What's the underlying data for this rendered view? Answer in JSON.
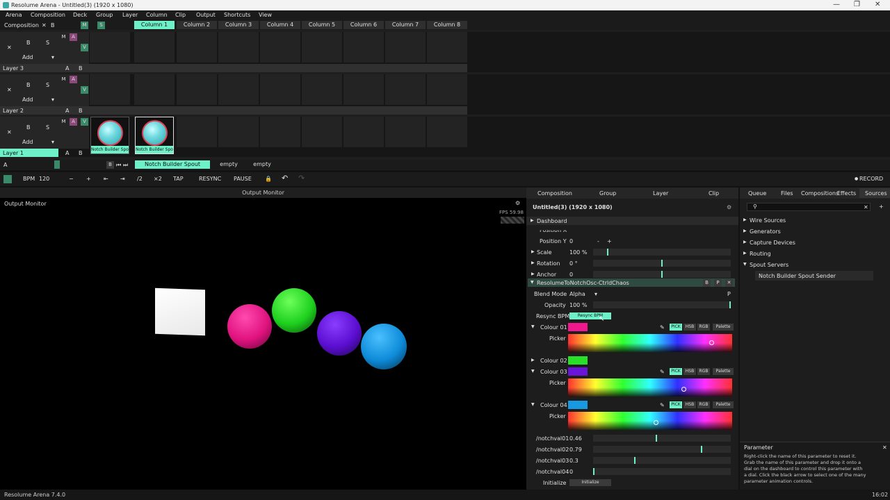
{
  "window": {
    "title": "Resolume Arena - Untitled(3) (1920 x 1080)",
    "min": "—",
    "max": "❐",
    "close": "✕"
  },
  "menu": [
    "Arena",
    "Composition",
    "Deck",
    "Group",
    "Layer",
    "Column",
    "Clip",
    "Output",
    "Shortcuts",
    "View"
  ],
  "composition_label": "Composition",
  "comp_x": "✕",
  "comp_b": "B",
  "comp_m": "M",
  "comp_s": "S",
  "columns": [
    "Column 1",
    "Column 2",
    "Column 3",
    "Column 4",
    "Column 5",
    "Column 6",
    "Column 7",
    "Column 8"
  ],
  "layers": [
    {
      "name": "Layer 3",
      "add": "Add"
    },
    {
      "name": "Layer 2",
      "add": "Add"
    },
    {
      "name": "Layer 1",
      "add": "Add"
    }
  ],
  "layer_btn": {
    "x": "✕",
    "b": "B",
    "s": "S",
    "m": "M",
    "a": "A",
    "v": "V",
    "ab_a": "A",
    "ab_b": "B"
  },
  "clips": [
    "Notch Builder Spo...",
    "Notch Builder Spo..."
  ],
  "crossfader": {
    "a": "A",
    "b": "B"
  },
  "deck_tabs": [
    "Notch Builder Spout Sender",
    "empty",
    "empty"
  ],
  "transport": {
    "bpm_label": "BPM",
    "bpm": "120",
    "minus": "−",
    "plus": "+",
    "half": "/2",
    "double": "×2",
    "tap": "TAP",
    "resync": "RESYNC",
    "pause": "PAUSE",
    "record": "RECORD"
  },
  "output_monitor": {
    "header": "Output Monitor",
    "label": "Output Monitor",
    "fps": "FPS 59.98"
  },
  "props_tabs": [
    "Composition",
    "Group",
    "Layer",
    "Clip"
  ],
  "props_title": "Untitled(3) (1920 x 1080)",
  "dashboard": "Dashboard",
  "transform": [
    {
      "label": "Position X",
      "value": "0"
    },
    {
      "label": "Position Y",
      "value": "0"
    },
    {
      "label": "Scale",
      "value": "100 %"
    },
    {
      "label": "Rotation",
      "value": "0 °"
    },
    {
      "label": "Anchor",
      "value": "0"
    }
  ],
  "effect": {
    "name": "ResolumeToNotchOsc-CtrldChaos",
    "b": "B",
    "p": "P",
    "x": "✕"
  },
  "blend": {
    "label": "Blend Mode",
    "value": "Alpha",
    "p": "P"
  },
  "opacity": {
    "label": "Opacity",
    "value": "100 %"
  },
  "resync_bpm": {
    "label": "Resync BPM",
    "button": "Resync BPM"
  },
  "colours": [
    {
      "label": "Colour 01",
      "color": "#f0188c"
    },
    {
      "label": "Colour 02",
      "color": "#28e028"
    },
    {
      "label": "Colour 03",
      "color": "#6a14d8"
    },
    {
      "label": "Colour 04",
      "color": "#1898e0"
    }
  ],
  "picker_label": "Picker",
  "color_modes": [
    "PICK",
    "HSB",
    "RGB",
    "Palette"
  ],
  "notch": [
    {
      "label": "/notchval01",
      "value": "0.46",
      "level": 0.46
    },
    {
      "label": "/notchval02",
      "value": "0.79",
      "level": 0.79
    },
    {
      "label": "/notchval03",
      "value": "0.3",
      "level": 0.3
    },
    {
      "label": "/notchval04",
      "value": "0",
      "level": 0
    }
  ],
  "initialize": {
    "label": "Initialize",
    "button": "Initialize"
  },
  "source_tabs": [
    "Queue",
    "Files",
    "Compositions",
    "Effects",
    "Sources"
  ],
  "source_tree": [
    "Wire Sources",
    "Generators",
    "Capture Devices",
    "Routing",
    "Spout Servers"
  ],
  "spout_item": "Notch Builder Spout Sender",
  "param_help": {
    "title": "Parameter",
    "text": "Right-click the name of this parameter to reset it. Grab the name of this parameter and drop it onto a dial on the dashboard to control this parameter with a dial. Click the black arrow to select one of the many parameter animation controls."
  },
  "status": {
    "version": "Resolume Arena 7.4.0",
    "time": "16:02"
  }
}
